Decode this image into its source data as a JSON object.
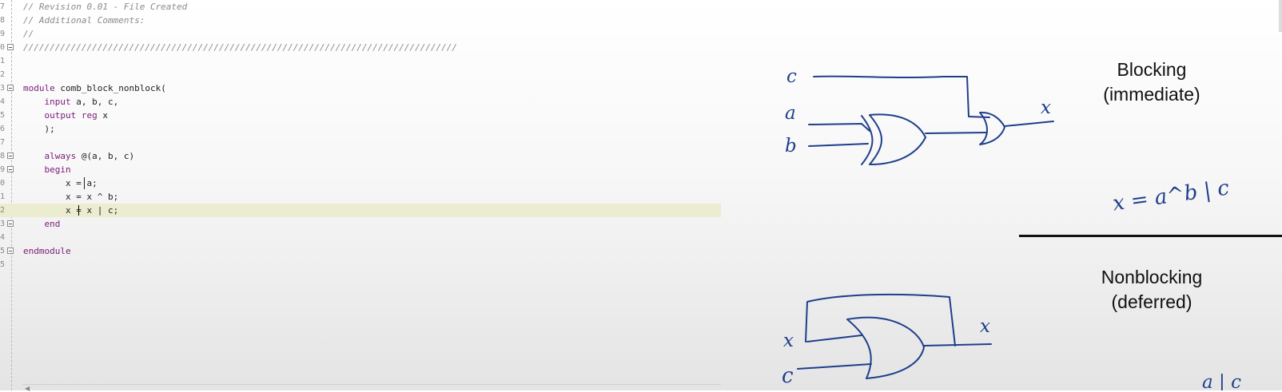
{
  "editor": {
    "lines": [
      {
        "ln": "7",
        "fold": false,
        "current": false,
        "parts": [
          {
            "t": "// Revision 0.01 - File Created",
            "c": "cmt"
          }
        ]
      },
      {
        "ln": "8",
        "fold": false,
        "current": false,
        "parts": [
          {
            "t": "// Additional Comments:",
            "c": "cmt"
          }
        ]
      },
      {
        "ln": "9",
        "fold": false,
        "current": false,
        "parts": [
          {
            "t": "//",
            "c": "cmt"
          }
        ]
      },
      {
        "ln": "0",
        "fold": true,
        "current": false,
        "parts": [
          {
            "t": "//////////////////////////////////////////////////////////////////////////////////",
            "c": "cmt"
          }
        ]
      },
      {
        "ln": "1",
        "fold": false,
        "current": false,
        "parts": []
      },
      {
        "ln": "2",
        "fold": false,
        "current": false,
        "parts": []
      },
      {
        "ln": "3",
        "fold": true,
        "current": false,
        "parts": [
          {
            "t": "module",
            "c": "kw"
          },
          {
            "t": " comb_block_nonblock(",
            "c": ""
          }
        ]
      },
      {
        "ln": "4",
        "fold": false,
        "current": false,
        "parts": [
          {
            "t": "    ",
            "c": ""
          },
          {
            "t": "input",
            "c": "kw"
          },
          {
            "t": " a, b, c,",
            "c": ""
          }
        ]
      },
      {
        "ln": "5",
        "fold": false,
        "current": false,
        "parts": [
          {
            "t": "    ",
            "c": ""
          },
          {
            "t": "output reg",
            "c": "kw"
          },
          {
            "t": " x",
            "c": ""
          }
        ]
      },
      {
        "ln": "6",
        "fold": false,
        "current": false,
        "parts": [
          {
            "t": "    );",
            "c": ""
          }
        ]
      },
      {
        "ln": "7",
        "fold": false,
        "current": false,
        "parts": []
      },
      {
        "ln": "8",
        "fold": true,
        "current": false,
        "parts": [
          {
            "t": "    ",
            "c": ""
          },
          {
            "t": "always",
            "c": "kw"
          },
          {
            "t": " @(a, b, c)",
            "c": ""
          }
        ]
      },
      {
        "ln": "9",
        "fold": true,
        "current": false,
        "parts": [
          {
            "t": "    ",
            "c": ""
          },
          {
            "t": "begin",
            "c": "kw"
          }
        ]
      },
      {
        "ln": "0",
        "fold": false,
        "current": false,
        "parts": [
          {
            "t": "        x = a;",
            "c": ""
          }
        ]
      },
      {
        "ln": "1",
        "fold": false,
        "current": false,
        "parts": [
          {
            "t": "        x = x ^ b;",
            "c": ""
          }
        ]
      },
      {
        "ln": "2",
        "fold": false,
        "current": true,
        "parts": [
          {
            "t": "        x = x | c;",
            "c": ""
          }
        ]
      },
      {
        "ln": "3",
        "fold": true,
        "current": false,
        "parts": [
          {
            "t": "    ",
            "c": ""
          },
          {
            "t": "end",
            "c": "kw"
          }
        ]
      },
      {
        "ln": "4",
        "fold": false,
        "current": false,
        "parts": []
      },
      {
        "ln": "5",
        "fold": true,
        "current": false,
        "parts": [
          {
            "t": "endmodule",
            "c": "kw"
          }
        ]
      },
      {
        "ln": "5",
        "fold": false,
        "current": false,
        "parts": []
      }
    ]
  },
  "whiteboard": {
    "blocking_title": "Blocking",
    "blocking_subtitle": "(immediate)",
    "nonblocking_title": "Nonblocking",
    "nonblocking_subtitle": "(deferred)",
    "sketch_blocking": {
      "input_c": "c",
      "input_a": "a",
      "input_b": "b",
      "output_x": "x",
      "equation": "x = a^b | c"
    },
    "sketch_nonblocking": {
      "input_x": "x",
      "input_c": "c",
      "output_x": "x",
      "partial_equation": "a | c"
    },
    "ink_color": "#1f3f8c"
  }
}
